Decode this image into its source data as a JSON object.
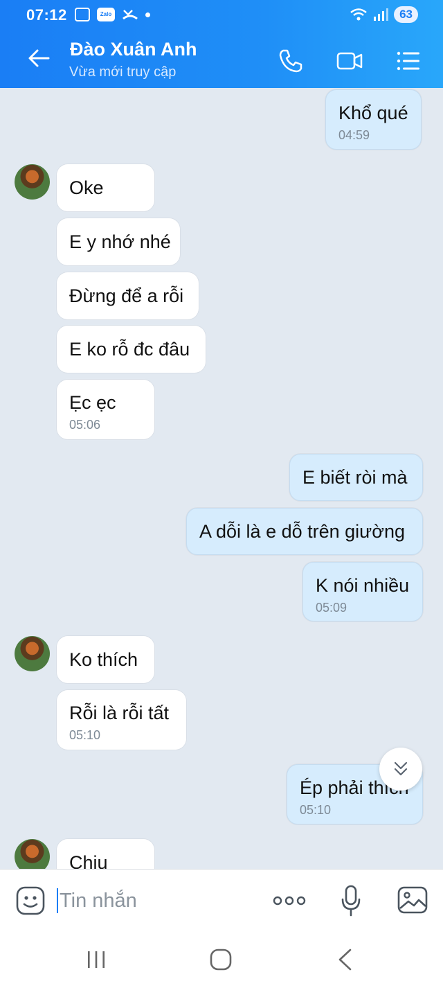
{
  "status_bar": {
    "time": "07:12",
    "zalo_badge": "Zalo",
    "battery": "63"
  },
  "header": {
    "contact_name": "Đào Xuân Anh",
    "contact_status": "Vừa mới truy cập",
    "icons": [
      "back-arrow-icon",
      "phone-icon",
      "video-call-icon",
      "menu-list-icon"
    ]
  },
  "messages": [
    {
      "dir": "out",
      "text": "Khổ qué",
      "time": "04:59"
    },
    {
      "dir": "in",
      "text": "Oke"
    },
    {
      "dir": "in",
      "text": "E y nhớ nhé"
    },
    {
      "dir": "in",
      "text": "Đừng để a rỗi"
    },
    {
      "dir": "in",
      "text": "E ko rỗ đc đâu"
    },
    {
      "dir": "in",
      "text": "Ẹc ẹc",
      "time": "05:06"
    },
    {
      "dir": "out",
      "text": "E biết ròi mà"
    },
    {
      "dir": "out",
      "text": "A dỗi là e dỗ trên giường"
    },
    {
      "dir": "out",
      "text": "K nói nhiều",
      "time": "05:09"
    },
    {
      "dir": "in",
      "text": "Ko thích"
    },
    {
      "dir": "in",
      "text": "Rỗi là rỗi tất",
      "time": "05:10"
    },
    {
      "dir": "out",
      "text": "Ép phải thích",
      "time": "05:10"
    },
    {
      "dir": "in",
      "text": "Chiu"
    }
  ],
  "composer": {
    "placeholder": "Tin nhắn"
  },
  "colors": {
    "header_blue": "#1a7ef5",
    "outgoing_bubble": "#d6ecfd",
    "incoming_bubble": "#ffffff",
    "chat_background": "#e2e9f1"
  }
}
